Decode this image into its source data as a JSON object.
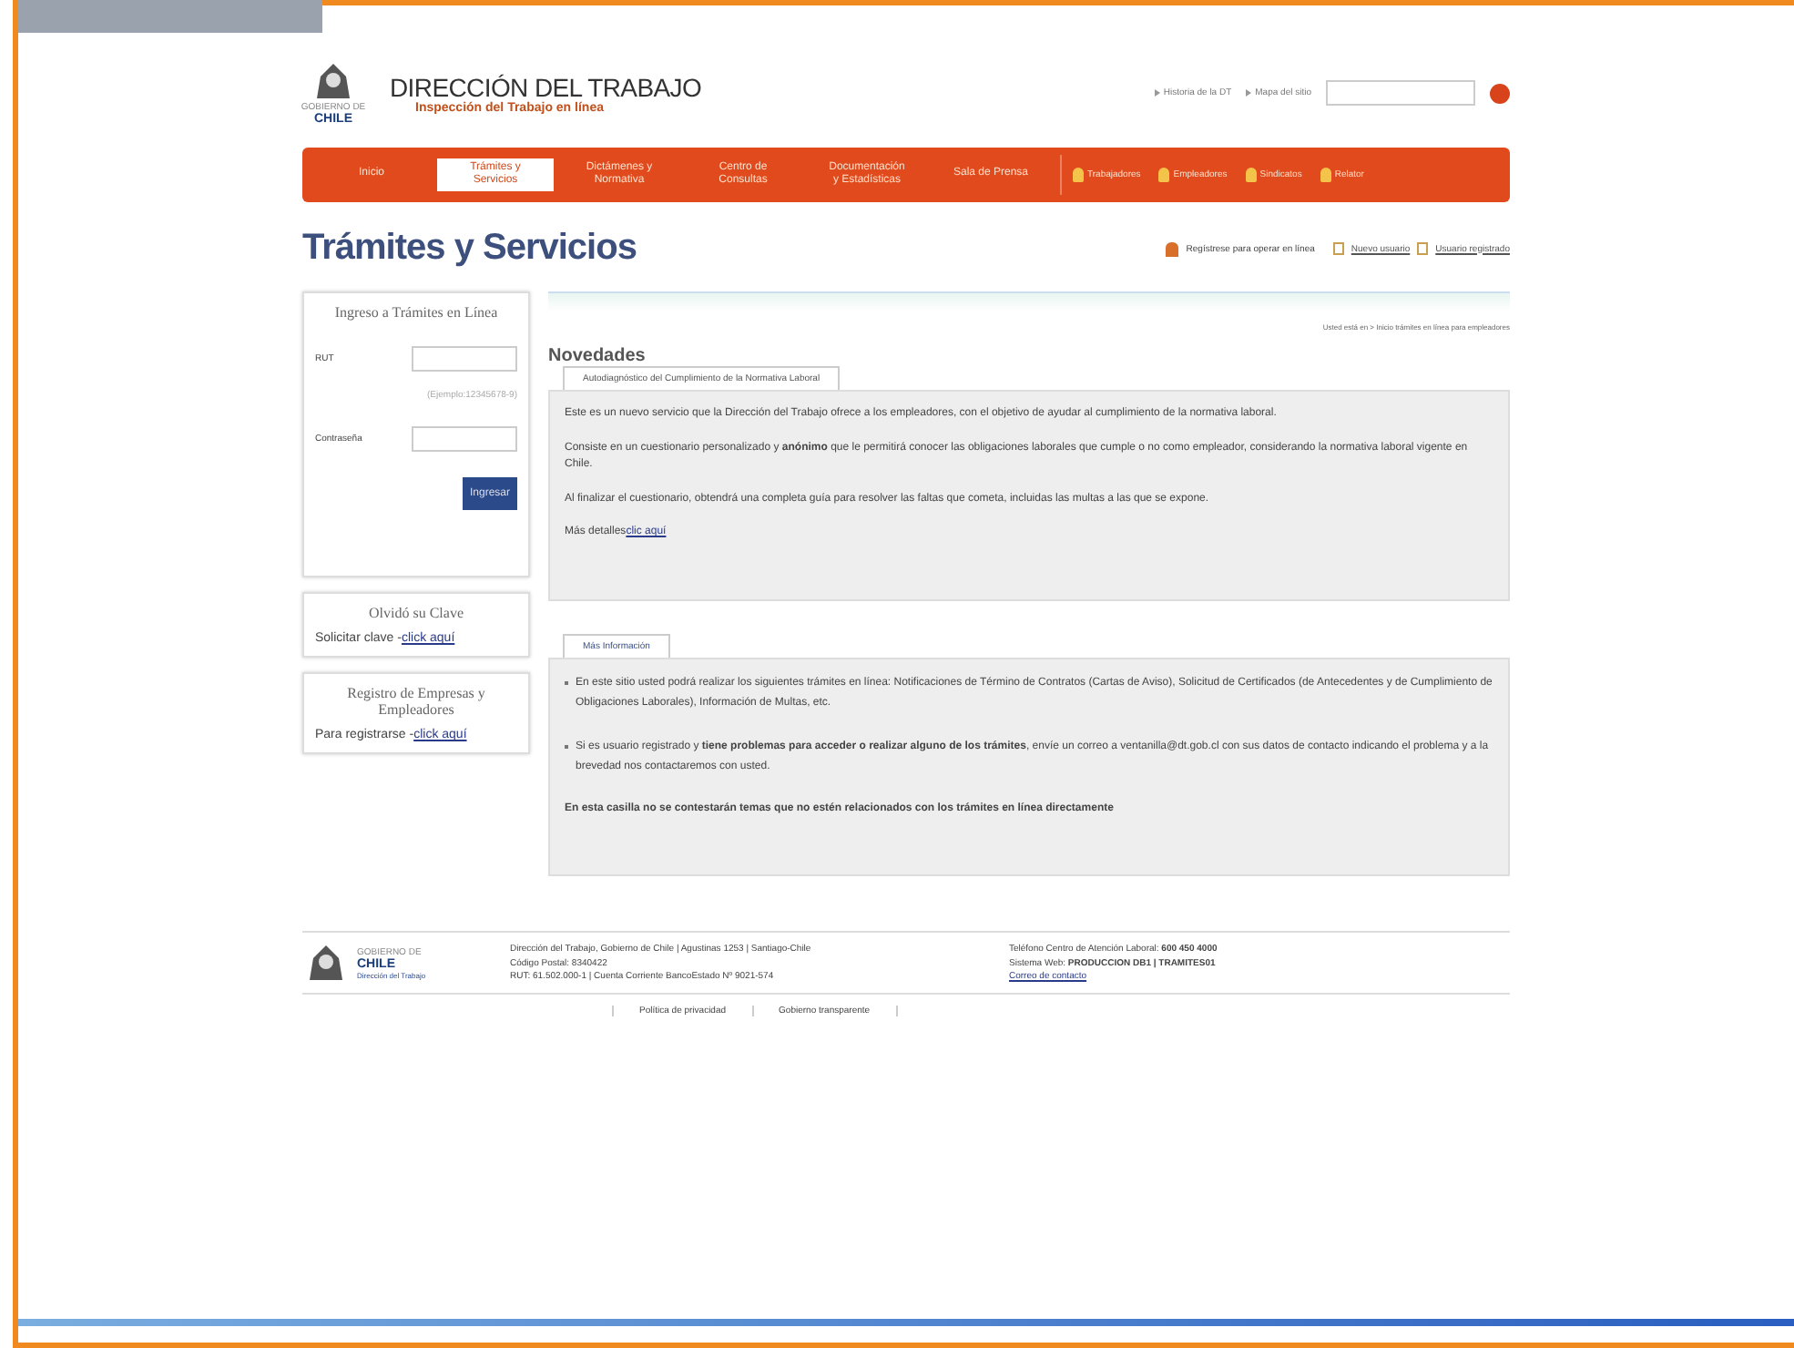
{
  "header": {
    "logo_small": "GOBIERNO DE",
    "logo_country": "CHILE",
    "title": "DIRECCIÓN DEL TRABAJO",
    "subtitle": "Inspección del Trabajo en línea",
    "top_links": [
      "Historia de la DT",
      "Mapa del sitio"
    ]
  },
  "nav": {
    "items": [
      {
        "label": "Inicio",
        "selected": false
      },
      {
        "label": "Trámites y Servicios",
        "selected": true
      },
      {
        "label": "Dictámenes y Normativa",
        "selected": false
      },
      {
        "label": "Centro de Consultas",
        "selected": false
      },
      {
        "label": "Documentación y Estadísticas",
        "selected": false
      },
      {
        "label": "Sala de Prensa",
        "selected": false
      }
    ],
    "profiles": [
      "Trabajadores",
      "Empleadores",
      "Sindicatos",
      "Relator"
    ]
  },
  "page_title": "Trámites y Servicios",
  "account_links": {
    "register": "Regístrese para operar en línea",
    "new_user": "Nuevo usuario",
    "registered_user": "Usuario registrado"
  },
  "login": {
    "title": "Ingreso a Trámites en Línea",
    "rut_label": "RUT",
    "rut_hint": "(Ejemplo:12345678-9)",
    "password_label": "Contraseña",
    "button": "Ingresar"
  },
  "forgot": {
    "title": "Olvidó su Clave",
    "text": "Solicitar clave - ",
    "link": "click aquí"
  },
  "registry": {
    "title": "Registro de Empresas y Empleadores",
    "text": "Para registrarse - ",
    "link": "click aquí"
  },
  "breadcrumb": "Usted está en > Inicio trámites en línea para empleadores",
  "news": {
    "heading": "Novedades",
    "tab": "Autodiagnóstico del Cumplimiento de la Normativa Laboral",
    "paragraphs": [
      "Este es un nuevo servicio que la Dirección del Trabajo ofrece a los empleadores, con el objetivo de ayudar al cumplimiento de la normativa laboral.",
      "Consiste en un cuestionario personalizado y **anónimo** que le permitirá conocer las obligaciones laborales que cumple o no como empleador, considerando la normativa laboral vigente en Chile.",
      "Al finalizar el cuestionario, obtendrá una completa guía para resolver las faltas que cometa, incluidas las multas a las que se expone."
    ],
    "more_text": "Más detalles ",
    "more_link": "clic aquí"
  },
  "info": {
    "tab": "Más Información",
    "bullets": [
      "En este sitio usted podrá realizar los siguientes trámites en línea: Notificaciones de Término de Contratos (Cartas de Aviso), Solicitud de Certificados (de Antecedentes y de Cumplimiento de Obligaciones Laborales), Información de Multas, etc.",
      "Si es usuario registrado y **tiene problemas para acceder o realizar alguno de los trámites**, envíe un correo a ventanilla@dt.gob.cl con sus datos de contacto indicando el problema y a la brevedad nos contactaremos con usted."
    ],
    "note": "En esta casilla no se contestarán temas que no estén relacionados con los trámites en línea directamente"
  },
  "footer": {
    "logo_small": "GOBIERNO DE",
    "logo_country": "CHILE",
    "logo_caption": "Dirección del Trabajo",
    "address": [
      "Dirección del Trabajo, Gobierno de Chile | Agustinas 1253 | Santiago-Chile",
      "Código Postal: 8340422",
      "RUT: 61.502.000-1 | Cuenta Corriente BancoEstado Nº 9021-574"
    ],
    "contact": [
      "Teléfono Centro de Atención Laboral: **600 450 4000**",
      "Sistema Web: **PRODUCCION DB1 | TRAMITES01**"
    ],
    "contact_link": "Correo de contacto",
    "links": [
      "Política de privacidad",
      "Gobierno transparente"
    ]
  }
}
